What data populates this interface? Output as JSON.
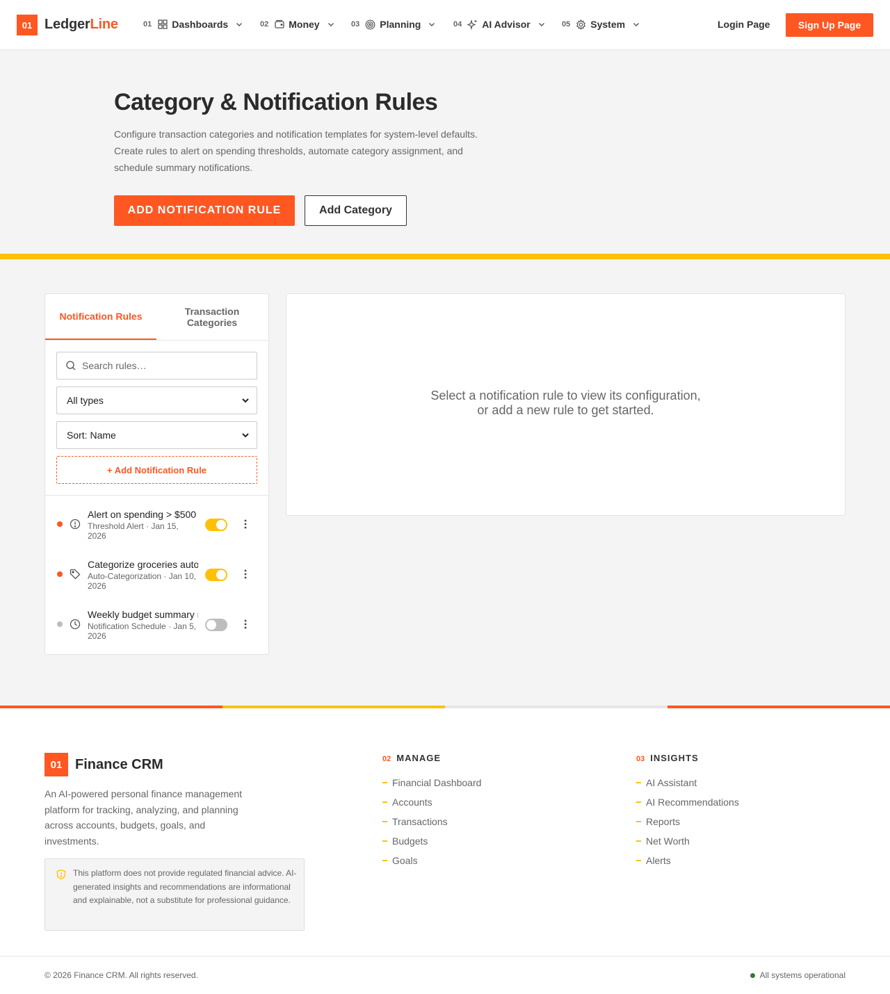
{
  "colors": {
    "accent": "#ff5722",
    "highlight": "#ffc107",
    "muted": "#666666",
    "status_ok": "#2e7d32",
    "inactive": "#bdbdbd"
  },
  "header": {
    "logo_badge": "01",
    "logo_part1": "Ledger",
    "logo_part2": "Line",
    "nav": [
      {
        "num": "01",
        "label": "Dashboards",
        "icon": "grid-icon"
      },
      {
        "num": "02",
        "label": "Money",
        "icon": "wallet-icon"
      },
      {
        "num": "03",
        "label": "Planning",
        "icon": "target-icon"
      },
      {
        "num": "04",
        "label": "AI Advisor",
        "icon": "sparkle-icon"
      },
      {
        "num": "05",
        "label": "System",
        "icon": "gear-icon"
      }
    ],
    "login": "Login Page",
    "signup": "Sign Up Page"
  },
  "hero": {
    "title": "Category & Notification Rules",
    "description": "Configure transaction categories and notification templates for system-level defaults. Create rules to alert on spending thresholds, automate category assignment, and schedule summary notifications.",
    "primary_button": "ADD NOTIFICATION RULE",
    "secondary_button": "Add Category"
  },
  "sidebar": {
    "tabs": [
      {
        "label": "Notification Rules",
        "active": true
      },
      {
        "label": "Transaction Categories",
        "active": false
      }
    ],
    "search_placeholder": "Search rules…",
    "type_filter": "All types",
    "sort": "Sort: Name",
    "add_rule": "+ Add Notification Rule",
    "rules": [
      {
        "name": "Alert on spending > $500",
        "meta": "Threshold Alert · Jan 15, 2026",
        "enabled": true,
        "icon": "alert-circle-icon",
        "dot": "#ff5722"
      },
      {
        "name": "Categorize groceries automatically",
        "meta": "Auto-Categorization · Jan 10, 2026",
        "enabled": true,
        "icon": "tag-icon",
        "dot": "#ff5722"
      },
      {
        "name": "Weekly budget summary notification",
        "meta": "Notification Schedule · Jan 5, 2026",
        "enabled": false,
        "icon": "clock-icon",
        "dot": "#bdbdbd"
      }
    ]
  },
  "detail": {
    "empty_line1": "Select a notification rule to view its configuration,",
    "empty_line2": "or add a new rule to get started."
  },
  "footer": {
    "badge": "01",
    "brand": "Finance CRM",
    "description": "An AI-powered personal finance management platform for tracking, analyzing, and planning across accounts, budgets, goals, and investments.",
    "disclaimer": "This platform does not provide regulated financial advice. AI-generated insights and recommendations are informational and explainable, not a substitute for professional guidance.",
    "columns": [
      {
        "num": "02",
        "title": "MANAGE",
        "links": [
          "Financial Dashboard",
          "Accounts",
          "Transactions",
          "Budgets",
          "Goals"
        ]
      },
      {
        "num": "03",
        "title": "INSIGHTS",
        "links": [
          "AI Assistant",
          "AI Recommendations",
          "Reports",
          "Net Worth",
          "Alerts"
        ]
      }
    ],
    "copyright": "© 2026 Finance CRM. All rights reserved.",
    "status": "All systems operational"
  }
}
